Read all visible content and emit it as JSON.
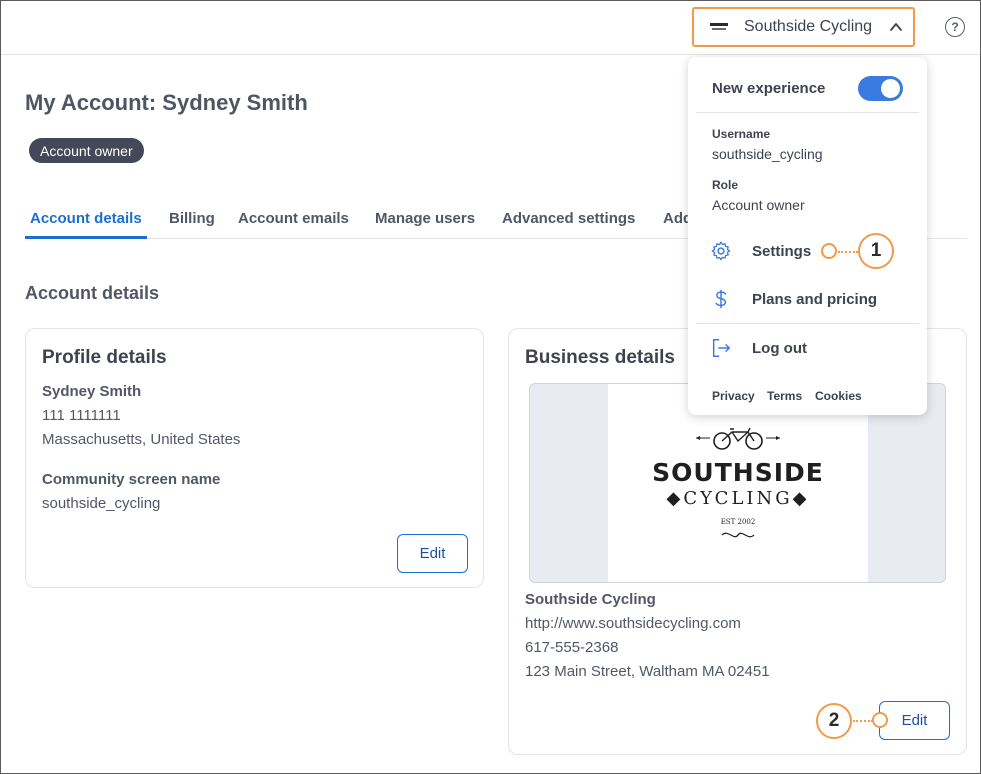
{
  "header": {
    "account_name": "Southside Cycling",
    "help_label": "?"
  },
  "page": {
    "title": "My Account: Sydney Smith",
    "badge": "Account owner",
    "section_title": "Account details"
  },
  "tabs": [
    {
      "label": "Account details",
      "active": true
    },
    {
      "label": "Billing"
    },
    {
      "label": "Account emails"
    },
    {
      "label": "Manage users"
    },
    {
      "label": "Advanced settings"
    },
    {
      "label": "Add"
    }
  ],
  "profile": {
    "title": "Profile details",
    "name": "Sydney Smith",
    "phone": "111 1111111",
    "location": "Massachusetts, United States",
    "screen_name_label": "Community screen name",
    "screen_name": "southside_cycling",
    "edit_label": "Edit"
  },
  "business": {
    "title": "Business details",
    "logo_line1": "SOUTHSIDE",
    "logo_line2": "◆CYCLING◆",
    "logo_est": "EST 2002",
    "name": "Southside Cycling",
    "website": "http://www.southsidecycling.com",
    "phone": "617-555-2368",
    "address": "123 Main Street, Waltham MA 02451",
    "edit_label": "Edit"
  },
  "dropdown": {
    "new_experience_label": "New experience",
    "new_experience_on": true,
    "username_label": "Username",
    "username": "southside_cycling",
    "role_label": "Role",
    "role": "Account owner",
    "settings_label": "Settings",
    "plans_label": "Plans and pricing",
    "logout_label": "Log out",
    "links": [
      "Privacy",
      "Terms",
      "Cookies"
    ]
  },
  "callouts": [
    "1",
    "2"
  ],
  "colors": {
    "accent": "#1c6fd1",
    "callout": "#f2994a",
    "badge_bg": "#434959",
    "toggle_on": "#3b7be0"
  }
}
